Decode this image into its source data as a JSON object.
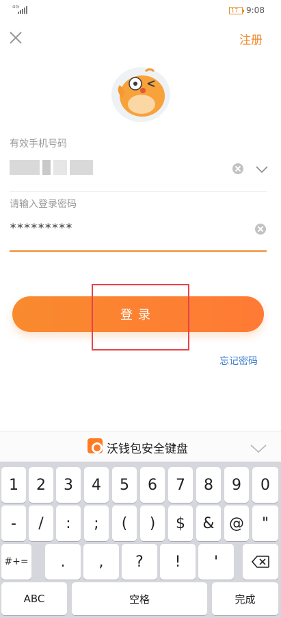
{
  "status_bar": {
    "network": "4G",
    "battery": "17",
    "time": "9:08"
  },
  "header": {
    "close_icon": "close-icon",
    "register_label": "注册"
  },
  "form": {
    "phone_label": "有效手机号码",
    "password_label": "请输入登录密码",
    "password_value": "*********",
    "login_label": "登录",
    "forgot_label": "忘记密码"
  },
  "keyboard": {
    "title": "沃钱包安全键盘",
    "row1": [
      "1",
      "2",
      "3",
      "4",
      "5",
      "6",
      "7",
      "8",
      "9",
      "0"
    ],
    "row2": [
      "-",
      "/",
      ":",
      ";",
      "(",
      ")",
      "$",
      "&",
      "@",
      "\""
    ],
    "row3": [
      "#+=",
      ".",
      ",",
      "?",
      "!",
      "'"
    ],
    "row4": [
      "ABC",
      "空格",
      "完成"
    ]
  },
  "colors": {
    "accent": "#f08a2c",
    "link": "#3d7fcf",
    "annotation": "#e8424a"
  }
}
